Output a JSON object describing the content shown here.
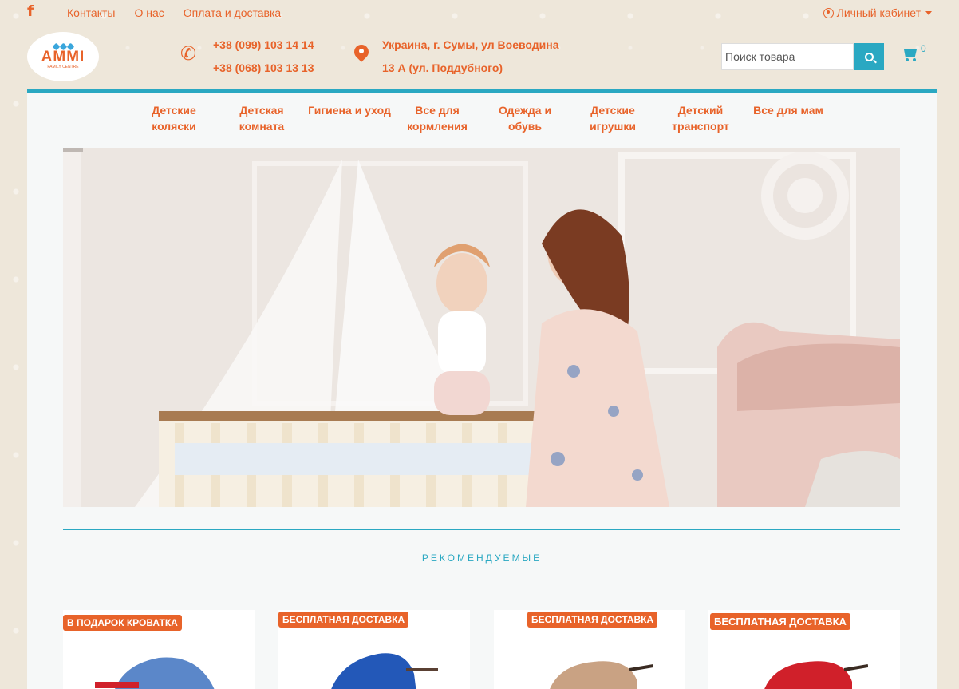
{
  "top_bar": {
    "links": [
      "Контакты",
      "О нас",
      "Оплата и доставка"
    ],
    "account_label": "Личный кабинет"
  },
  "header": {
    "logo_name": "AMMI",
    "logo_sub": "FAMILY CENTRE",
    "phones": [
      "+38 (099) 103 14 14",
      "+38 (068) 103 13 13"
    ],
    "address": [
      "Украина, г. Сумы, ул Воеводина",
      "13 А (ул. Поддубного)"
    ],
    "search_placeholder": "Поиск товара",
    "cart_count": "0"
  },
  "nav": {
    "items": [
      {
        "label": "Детские коляски"
      },
      {
        "label": "Детская комната"
      },
      {
        "label": "Гигиена и уход"
      },
      {
        "label": "Все для кормления"
      },
      {
        "label": "Одежда и обувь"
      },
      {
        "label": "Детские игрушки"
      },
      {
        "label": "Детский транспорт"
      },
      {
        "label": "Все для мам"
      }
    ]
  },
  "section": {
    "recommended_title": "РЕКОМЕНДУЕМЫЕ"
  },
  "products": [
    {
      "badge": "В ПОДАРОК КРОВАТКА",
      "color": "#5b87c9"
    },
    {
      "badge": "БЕСПЛАТНАЯ ДОСТАВКА",
      "color": "#2358b8"
    },
    {
      "badge": "БЕСПЛАТНАЯ ДОСТАВКА",
      "color": "#c9a283"
    },
    {
      "badge": "БЕСПЛАТНАЯ ДОСТАВКА",
      "color": "#d0202a"
    }
  ],
  "colors": {
    "accent_orange": "#e8632a",
    "accent_teal": "#2aa8c2"
  }
}
